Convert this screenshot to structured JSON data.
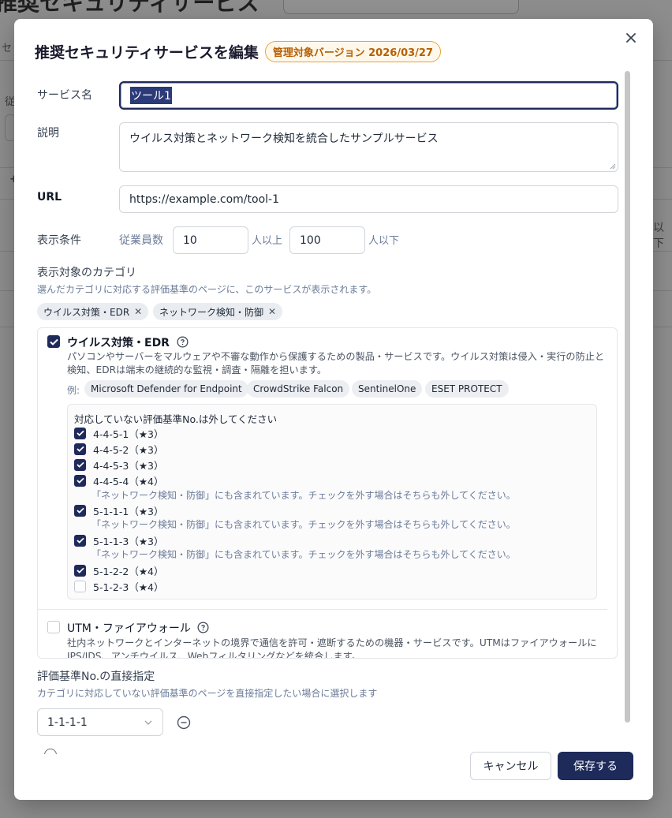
{
  "background": {
    "page_title": "推奨セキュリティサービス",
    "side_labels": [
      "セ",
      "従",
      "+",
      "以下"
    ]
  },
  "modal": {
    "title": "推奨セキュリティサービスを編集",
    "version_badge": "管理対象バージョン 2026/03/27",
    "close_icon": "close-icon"
  },
  "form": {
    "service_name": {
      "label": "サービス名",
      "value": "ツール1"
    },
    "description": {
      "label": "説明",
      "value": "ウイルス対策とネットワーク検知を統合したサンプルサービス"
    },
    "url": {
      "label": "URL",
      "value": "https://example.com/tool-1"
    },
    "display_condition": {
      "label": "表示条件",
      "employees_label": "従業員数",
      "min_value": "10",
      "min_suffix": "人以上",
      "max_value": "100",
      "max_suffix": "人以下"
    },
    "categories": {
      "label": "表示対象のカテゴリ",
      "help": "選んだカテゴリに対応する評価基準のページに、このサービスが表示されます。",
      "selected_chips": [
        "ウイルス対策・EDR",
        "ネットワーク検知・防御"
      ],
      "items": [
        {
          "title": "ウイルス対策・EDR",
          "checked": true,
          "description_line1": "パソコンやサーバーをマルウェアや不審な動作から保護するための製品・サービスです。ウイルス対策は侵入・実行の防止と",
          "description_line2": "検知、EDRは端末の継続的な監視・調査・隔離を担います。",
          "examples_label": "例:",
          "examples": [
            "Microsoft Defender for Endpoint",
            "CrowdStrike Falcon",
            "SentinelOne",
            "ESET PROTECT"
          ],
          "criteria_header": "対応していない評価基準No.は外してください",
          "criteria": [
            {
              "label": "4-4-5-1（★3）",
              "checked": true,
              "note": ""
            },
            {
              "label": "4-4-5-2（★3）",
              "checked": true,
              "note": ""
            },
            {
              "label": "4-4-5-3（★3）",
              "checked": true,
              "note": ""
            },
            {
              "label": "4-4-5-4（★4）",
              "checked": true,
              "note": "「ネットワーク検知・防御」にも含まれています。チェックを外す場合はそちらも外してください。"
            },
            {
              "label": "5-1-1-1（★3）",
              "checked": true,
              "note": "「ネットワーク検知・防御」にも含まれています。チェックを外す場合はそちらも外してください。"
            },
            {
              "label": "5-1-1-3（★3）",
              "checked": true,
              "note": "「ネットワーク検知・防御」にも含まれています。チェックを外す場合はそちらも外してください。"
            },
            {
              "label": "5-1-2-2（★4）",
              "checked": true,
              "note": ""
            },
            {
              "label": "5-1-2-3（★4）",
              "checked": false,
              "note": ""
            }
          ]
        },
        {
          "title": "UTM・ファイアウォール",
          "checked": false,
          "description_line1": "社内ネットワークとインターネットの境界で通信を許可・遮断するための機器・サービスです。UTMはファイアウォールに",
          "description_line2": "IPS/IDS、アンチウイルス、Webフィルタリングなどを統合します。"
        }
      ]
    },
    "direct_spec": {
      "label": "評価基準No.の直接指定",
      "help": "カテゴリに対応していない評価基準のページを直接指定したい場合に選択します",
      "selected": "1-1-1-1"
    }
  },
  "footer": {
    "cancel_label": "キャンセル",
    "save_label": "保存する"
  },
  "colors": {
    "primary": "#1e2a5a",
    "badge_border": "#e8a33d",
    "badge_text": "#b45f06",
    "muted_text": "#6b7c99"
  }
}
